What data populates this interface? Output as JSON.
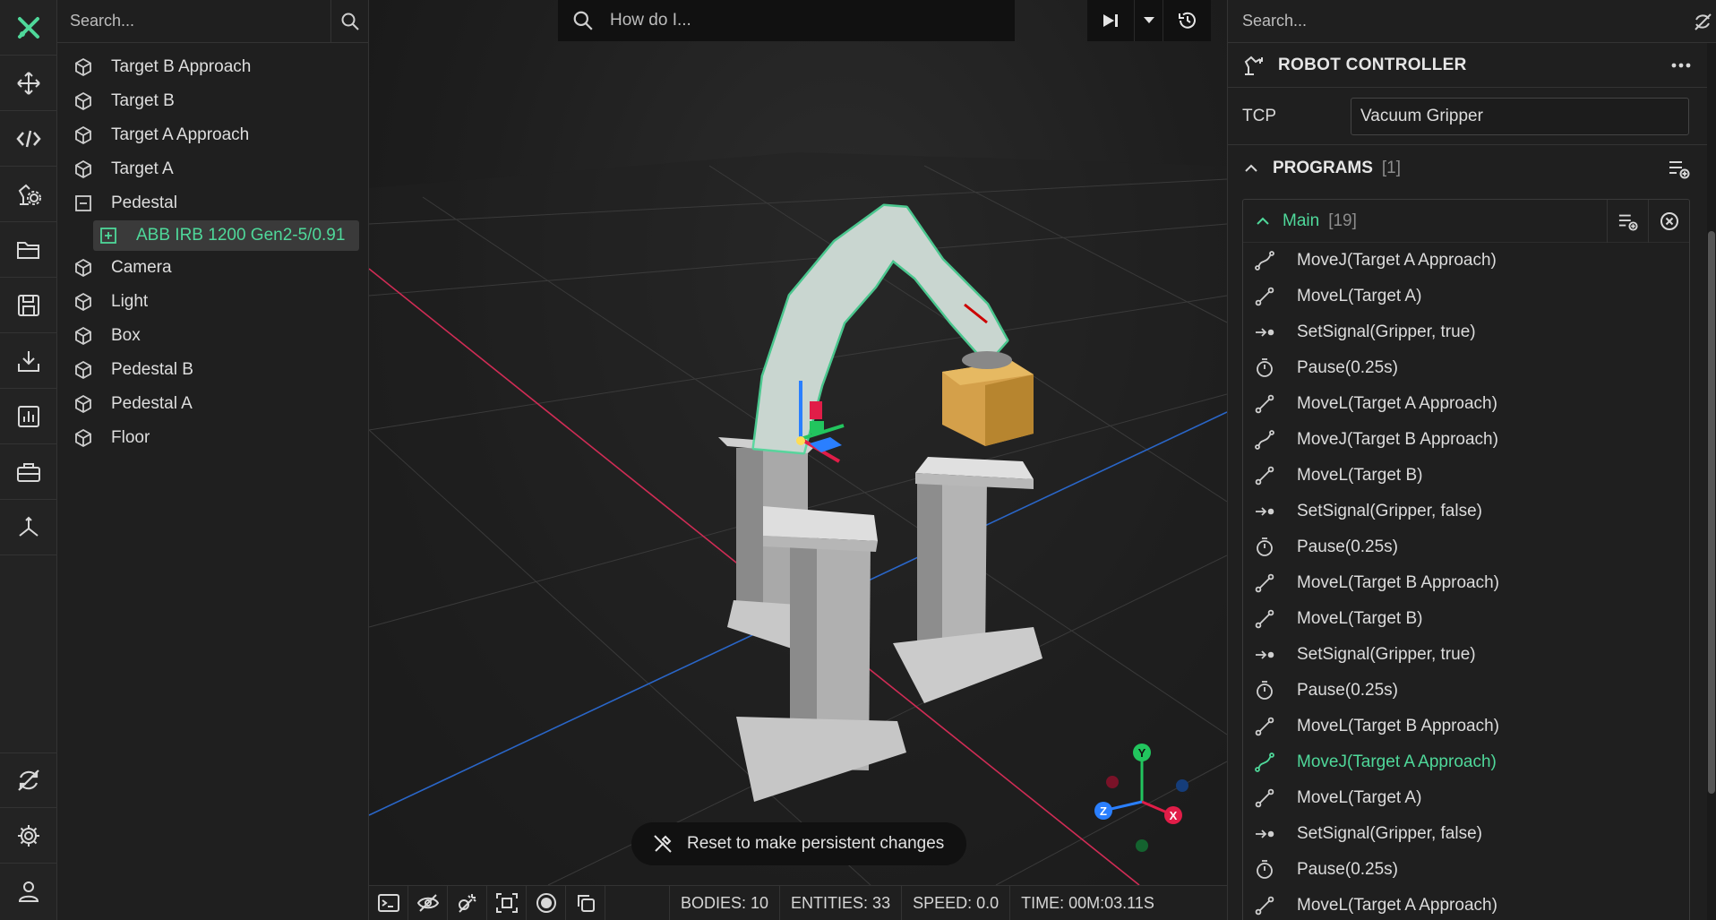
{
  "toolbar": {
    "items": [
      {
        "name": "logo-icon"
      },
      {
        "name": "move-icon"
      },
      {
        "name": "code-icon"
      },
      {
        "name": "robot-settings-icon"
      },
      {
        "name": "folder-icon"
      },
      {
        "name": "save-icon"
      },
      {
        "name": "download-icon"
      },
      {
        "name": "chart-icon"
      },
      {
        "name": "toolbox-icon"
      },
      {
        "name": "axes-icon"
      }
    ],
    "bottom": [
      {
        "name": "sync-icon"
      },
      {
        "name": "gear-icon"
      },
      {
        "name": "user-icon"
      }
    ],
    "accent": "#4fd89a"
  },
  "scene_tree": {
    "search_placeholder": "Search...",
    "items": [
      {
        "label": "Target B Approach",
        "icon": "cube-icon"
      },
      {
        "label": "Target B",
        "icon": "cube-icon"
      },
      {
        "label": "Target A Approach",
        "icon": "cube-icon"
      },
      {
        "label": "Target A",
        "icon": "cube-icon"
      },
      {
        "label": "Pedestal",
        "icon": "collapse-square-icon"
      },
      {
        "label": "ABB IRB 1200 Gen2-5/0.91",
        "icon": "expand-square-icon"
      },
      {
        "label": "Camera",
        "icon": "cube-icon"
      },
      {
        "label": "Light",
        "icon": "cube-icon"
      },
      {
        "label": "Box",
        "icon": "cube-icon"
      },
      {
        "label": "Pedestal B",
        "icon": "cube-icon"
      },
      {
        "label": "Pedestal A",
        "icon": "cube-icon"
      },
      {
        "label": "Floor",
        "icon": "cube-icon"
      }
    ]
  },
  "viewport": {
    "howdo_placeholder": "How do I...",
    "toast": "Reset to make persistent changes",
    "gizmo": {
      "y": "Y",
      "x": "X",
      "z": "Z"
    }
  },
  "statusbar": {
    "bodies": "BODIES: 10",
    "entities": "ENTITIES: 33",
    "speed": "SPEED: 0.0",
    "time": "TIME: 00M:03.11S"
  },
  "right_panel": {
    "search_placeholder": "Search...",
    "title": "ROBOT CONTROLLER",
    "tcp_label": "TCP",
    "tcp_value": "Vacuum Gripper",
    "programs_title": "PROGRAMS",
    "programs_count": "[1]",
    "program_name": "Main",
    "program_count": "[19]",
    "statements": [
      {
        "text": "MoveJ(Target A Approach)",
        "icon": "movej-icon"
      },
      {
        "text": "MoveL(Target A)",
        "icon": "movel-icon"
      },
      {
        "text": "SetSignal(Gripper, true)",
        "icon": "signal-icon"
      },
      {
        "text": "Pause(0.25s)",
        "icon": "timer-icon"
      },
      {
        "text": "MoveL(Target A Approach)",
        "icon": "movel-icon"
      },
      {
        "text": "MoveJ(Target B Approach)",
        "icon": "movej-icon"
      },
      {
        "text": "MoveL(Target B)",
        "icon": "movel-icon"
      },
      {
        "text": "SetSignal(Gripper, false)",
        "icon": "signal-icon"
      },
      {
        "text": "Pause(0.25s)",
        "icon": "timer-icon"
      },
      {
        "text": "MoveL(Target B Approach)",
        "icon": "movel-icon"
      },
      {
        "text": "MoveL(Target B)",
        "icon": "movel-icon"
      },
      {
        "text": "SetSignal(Gripper, true)",
        "icon": "signal-icon"
      },
      {
        "text": "Pause(0.25s)",
        "icon": "timer-icon"
      },
      {
        "text": "MoveL(Target B Approach)",
        "icon": "movel-icon"
      },
      {
        "text": "MoveJ(Target A Approach)",
        "icon": "movej-icon"
      },
      {
        "text": "MoveL(Target A)",
        "icon": "movel-icon"
      },
      {
        "text": "SetSignal(Gripper, false)",
        "icon": "signal-icon"
      },
      {
        "text": "Pause(0.25s)",
        "icon": "timer-icon"
      },
      {
        "text": "MoveL(Target A Approach)",
        "icon": "movel-icon"
      }
    ],
    "active_statement": 14
  }
}
